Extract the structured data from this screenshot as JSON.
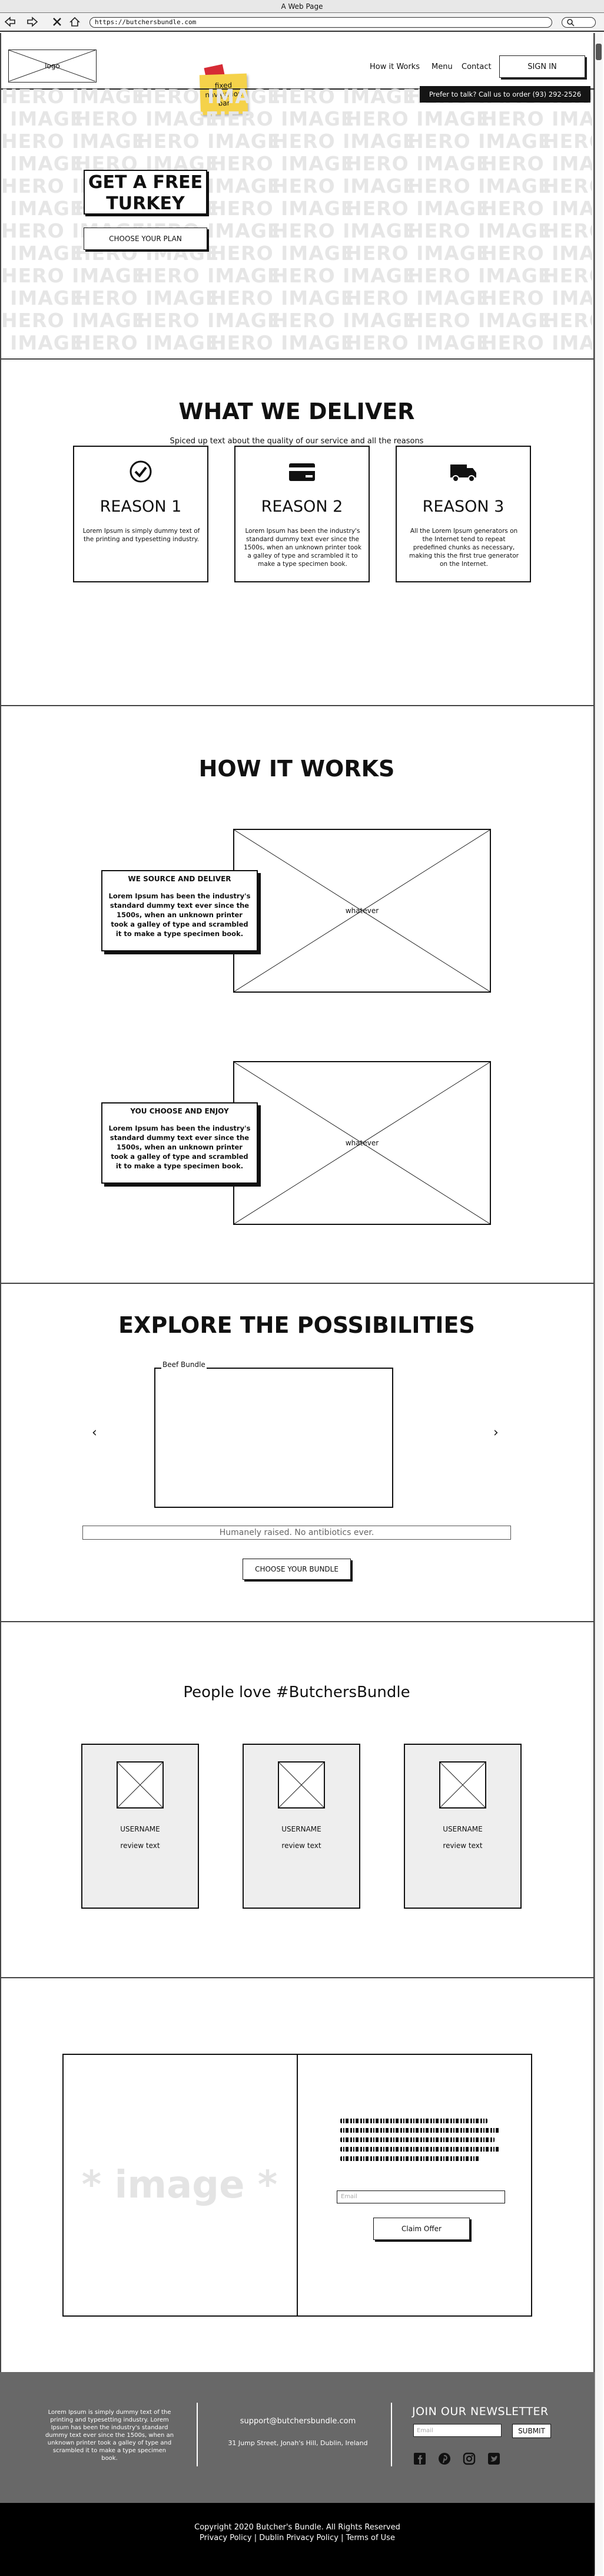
{
  "browser": {
    "window_title": "A Web Page",
    "url": "https://butchersbundle.com"
  },
  "header": {
    "logo_label": "logo",
    "sticky_note": "fixed navigation bar",
    "nav": [
      "How it Works",
      "Menu",
      "Contact"
    ],
    "signin_label": "SIGN IN",
    "call_text": "Prefer to talk? Call us to order (93) 292-2526"
  },
  "hero": {
    "bg_word": "HERO IMAGE",
    "cta_title": "GET A FREE TURKEY",
    "plan_button": "CHOOSE YOUR PLAN"
  },
  "deliver": {
    "title": "WHAT WE DELIVER",
    "subtitle": "Spiced up text about the quality of our service and all the reasons why you should join us.",
    "reasons": [
      {
        "icon": "check-circle-icon",
        "title": "REASON 1",
        "body": "Lorem Ipsum is simply dummy text of the printing and typesetting industry."
      },
      {
        "icon": "credit-card-icon",
        "title": "REASON 2",
        "body": "Lorem Ipsum has been the industry's standard dummy text ever since the 1500s, when an unknown printer took a galley of type and scrambled it to make a type specimen book."
      },
      {
        "icon": "truck-icon",
        "title": "REASON 3",
        "body": "All the Lorem Ipsum generators on the Internet tend to repeat predefined chunks as necessary, making this the first true generator on the Internet."
      }
    ]
  },
  "how": {
    "title": "HOW IT WORKS",
    "image_label": "whatever",
    "steps": [
      {
        "title": "WE SOURCE AND DELIVER",
        "body": "Lorem Ipsum has been the industry's standard dummy text ever since the 1500s, when an unknown printer took a galley of type and scrambled it to make a type specimen book."
      },
      {
        "title": "YOU CHOOSE AND ENJOY",
        "body": "Lorem Ipsum has been the industry's standard dummy text ever since the 1500s, when an unknown printer took a galley of type and scrambled it to make a type specimen book."
      }
    ]
  },
  "explore": {
    "title": "EXPLORE THE POSSIBILITIES",
    "carousel_label": "Beef Bundle",
    "prev": "‹",
    "next": "›",
    "tagline": "Humanely raised. No antibiotics ever.",
    "button": "CHOOSE YOUR BUNDLE"
  },
  "reviews": {
    "title": "People love #ButchersBundle",
    "items": [
      {
        "username": "USERNAME",
        "text": "review text"
      },
      {
        "username": "USERNAME",
        "text": "review text"
      },
      {
        "username": "USERNAME",
        "text": "review text"
      }
    ]
  },
  "offer": {
    "image_label": "* image *",
    "email_placeholder": "Email",
    "button": "Claim Offer"
  },
  "footer": {
    "about": "Lorem Ipsum is simply dummy text of the printing and typesetting industry. Lorem Ipsum has been the industry's standard dummy text ever since the 1500s, when an unknown printer took a galley of type and scrambled it to make a type specimen book.",
    "email": "support@butchersbundle.com",
    "address": "31 Jump Street, Jonah's Hill, Dublin, Ireland",
    "newsletter_title": "JOIN OUR NEWSLETTER",
    "newsletter_placeholder": "Email",
    "submit": "SUBMIT",
    "copyright": "Copyright 2020 Butcher's Bundle. All Rights Reserved",
    "links": "Privacy Policy | Dublin Privacy Policy | Terms of Use"
  }
}
